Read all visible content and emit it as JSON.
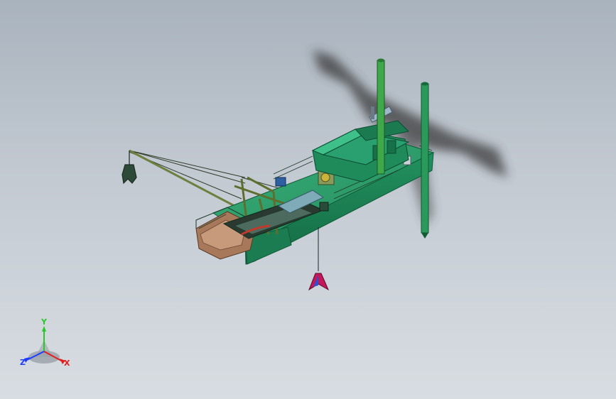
{
  "triad": {
    "x_label": "X",
    "y_label": "Y",
    "z_label": "Z",
    "x_color": "#e02020",
    "y_color": "#28c828",
    "z_color": "#1e3cff"
  },
  "model": {
    "hull_color": "#1f8a5a",
    "hull_dark": "#12603c",
    "deck_wood": "#a8785a",
    "spud_color": "#2a9a5a",
    "boom_color": "#6f7f3f"
  }
}
